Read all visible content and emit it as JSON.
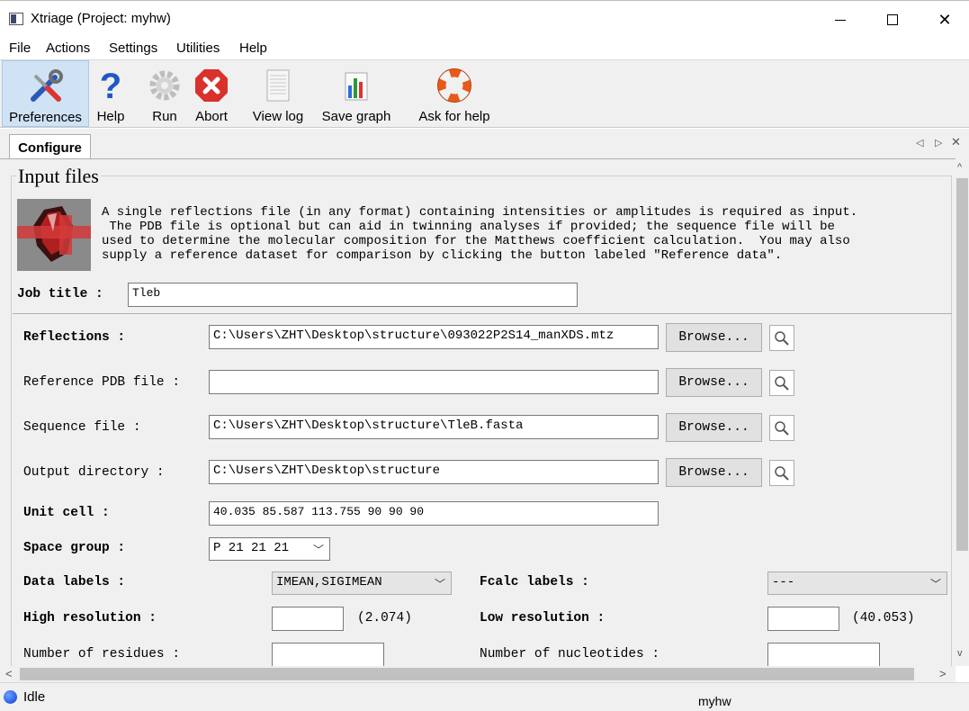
{
  "window": {
    "title": "Xtriage (Project: myhw)",
    "min_symbol": "",
    "max_symbol": "",
    "close_symbol": "✕"
  },
  "menu": [
    "File",
    "Actions",
    "Settings",
    "Utilities",
    "Help"
  ],
  "toolbar": [
    {
      "label": "Preferences",
      "icon": "wrench-screwdriver-icon",
      "active": true
    },
    {
      "label": "Help",
      "icon": "question-mark-icon"
    },
    {
      "label": "Run",
      "icon": "gear-icon"
    },
    {
      "label": "Abort",
      "icon": "abort-x-icon"
    },
    {
      "label": "View log",
      "icon": "log-document-icon"
    },
    {
      "label": "Save graph",
      "icon": "bar-graph-icon"
    },
    {
      "label": "Ask for help",
      "icon": "life-ring-icon"
    }
  ],
  "tabs": [
    {
      "label": "Configure",
      "active": true
    }
  ],
  "tab_controls": {
    "prev": "◁",
    "next": "▷",
    "close": "✕"
  },
  "section": {
    "title": "Input files",
    "description": "A single reflections file (in any format) containing intensities or amplitudes is required as input.\n The PDB file is optional but can aid in twinning analyses if provided; the sequence file will be\nused to determine the molecular composition for the Matthews coefficient calculation.  You may also\nsupply a reference dataset for comparison by clicking the button labeled \"Reference data\"."
  },
  "job_title": {
    "label": "Job title :",
    "value": "Tleb"
  },
  "files": [
    {
      "label": "Reflections :",
      "bold": true,
      "value": "C:\\Users\\ZHT\\Desktop\\structure\\093022P2S14_manXDS.mtz",
      "browse": "Browse..."
    },
    {
      "label": "Reference PDB file :",
      "bold": false,
      "value": "",
      "browse": "Browse..."
    },
    {
      "label": "Sequence file :",
      "bold": false,
      "value": "C:\\Users\\ZHT\\Desktop\\structure\\TleB.fasta",
      "browse": "Browse..."
    },
    {
      "label": "Output directory :",
      "bold": false,
      "value": "C:\\Users\\ZHT\\Desktop\\structure",
      "browse": "Browse..."
    }
  ],
  "unit_cell": {
    "label": "Unit cell :",
    "value": "40.035 85.587 113.755 90 90 90"
  },
  "space_group": {
    "label": "Space group :",
    "value": "P 21 21 21"
  },
  "data_labels": {
    "label": "Data labels :",
    "value": "IMEAN,SIGIMEAN"
  },
  "fcalc_labels": {
    "label": "Fcalc labels :",
    "value": "---"
  },
  "high_resolution": {
    "label": "High resolution :",
    "value": "",
    "hint": "(2.074)"
  },
  "low_resolution": {
    "label": "Low resolution :",
    "value": "",
    "hint": "(40.053)"
  },
  "num_residues": {
    "label": "Number of residues :",
    "value": ""
  },
  "num_nucleotides": {
    "label": "Number of nucleotides :",
    "value": ""
  },
  "scroll": {
    "up": "^",
    "down": "v",
    "left": "<",
    "right": ">"
  },
  "status": {
    "text": "Idle",
    "project": "myhw"
  },
  "colors": {
    "active_tool": "#cfe3f5",
    "status_dot": "#1a56e8",
    "abort": "#d9312b"
  }
}
